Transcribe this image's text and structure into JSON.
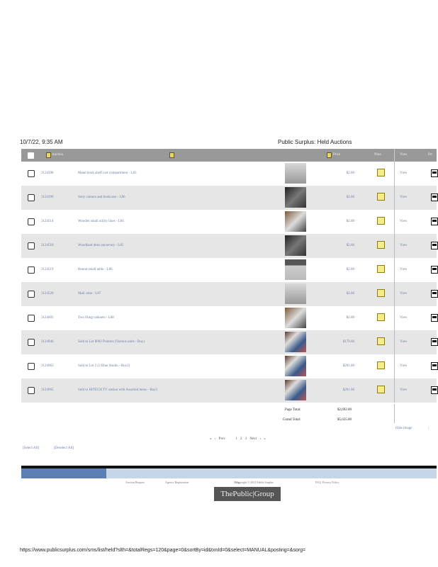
{
  "print_header": {
    "timestamp": "10/7/22, 9:35 AM",
    "page_title": "Public Surplus: Held Auctions"
  },
  "table": {
    "headers": {
      "auction": "Auction",
      "price": "Price",
      "note": "Note",
      "view": "View",
      "print": "Prt"
    },
    "rows": [
      {
        "id": "3124398",
        "desc": "Metal book shelf cart compartment - L83",
        "price": "$2.00",
        "view": "View",
        "thumb": "grey"
      },
      {
        "id": "3124399",
        "desc": "Sony camera and bookcase - L86",
        "price": "$2.00",
        "view": "View",
        "thumb": "dark"
      },
      {
        "id": "3124514",
        "desc": "Wooden small utility lines - L84",
        "price": "$2.00",
        "view": "View",
        "thumb": "wood"
      },
      {
        "id": "3124518",
        "desc": "Woodland desk university - L85",
        "price": "$2.00",
        "view": "View",
        "thumb": "dark"
      },
      {
        "id": "3124519",
        "desc": "Round small table - L86",
        "price": "$2.00",
        "view": "View",
        "thumb": "table"
      },
      {
        "id": "3124520",
        "desc": "Mail cube - L87",
        "price": "$2.00",
        "view": "View",
        "thumb": "grey"
      },
      {
        "id": "3124605",
        "desc": "Two filing cabinets - L88",
        "price": "$2.00",
        "view": "View",
        "thumb": "wood"
      },
      {
        "id": "3124946",
        "desc": "Sold to Lot 8002 Printers (Various units - Buy)",
        "price": "$170.00",
        "view": "View",
        "thumb": "mixed"
      },
      {
        "id": "3124963",
        "desc": "Sold to Lot 2 (3 Blue Studio - Buy2)",
        "price": "$201.00",
        "view": "View",
        "thumb": "mixed"
      },
      {
        "id": "3124965",
        "desc": "Sold to HITECH TV station with Assorted items - Buy3",
        "price": "$201.00",
        "view": "View",
        "thumb": "mixed"
      }
    ]
  },
  "totals": {
    "page_label": "Page Total:",
    "page_value": "$2,692.00",
    "grand_label": "Grand Total:",
    "grand_value": "$5,635.00",
    "hide_label": "Hide Image",
    "sep": "|"
  },
  "pager": {
    "first": "«",
    "prev_arrow": "‹",
    "prev": "Prev",
    "p1": "1",
    "p2": "2",
    "p3": "3",
    "next": "Next",
    "next_arrow": "›",
    "last": "»"
  },
  "selection": {
    "select_all": "[Select All]",
    "deselect_all": "[Deselect All]"
  },
  "footer": {
    "links": [
      "Auction Request",
      "Agency Registration",
      "Help",
      "Copyright © 2022 Public Surplus",
      "FAQ",
      "Privacy Policy"
    ],
    "logo": "ThePublic|Group"
  },
  "url": "https://www.publicsurplus.com/sms/list/held?slth=&totalRegs=120&page=0&sortBy=id&txnId=0&select=MANUAL&posting=&sorg="
}
